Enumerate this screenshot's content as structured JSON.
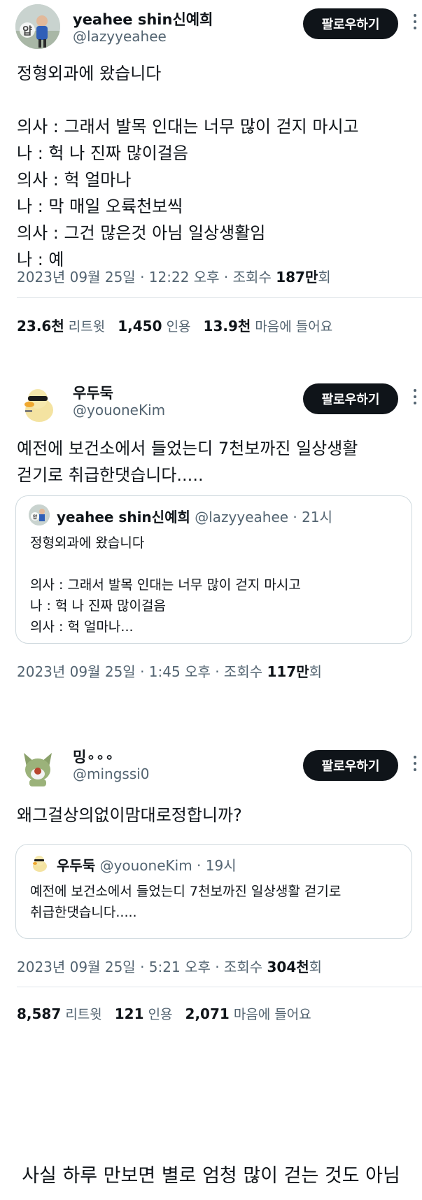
{
  "tweets": [
    {
      "name": "yeahee shin신예희",
      "handle": "@lazyyeahee",
      "follow_label": "팔로우하기",
      "avatar_text": "얍",
      "text": "정형외과에 왔습니다\n\n의사 : 그래서 발목 인대는 너무 많이 걷지 마시고\n나 : 헉 나 진짜 많이걸음\n의사 : 헉 얼마나\n나 : 막 매일 오륙천보씩\n의사 : 그건 많은것 아님 일상생활임\n나 : 예",
      "date": "2023년 09월 25일 · 12:22 오후 · 조회수 ",
      "views": "187만",
      "views_suffix": "회",
      "retweets": "23.6천",
      "retweets_label": "리트윗",
      "quotes": "1,450",
      "quotes_label": "인용",
      "likes": "13.9천",
      "likes_label": "마음에 들어요"
    },
    {
      "name": "우두둑",
      "handle": "@youoneKim",
      "follow_label": "팔로우하기",
      "text": "예전에 보건소에서 들었는디 7천보까진 일상생활\n걷기로 취급한댓습니다.....",
      "quote": {
        "name": "yeahee shin신예희",
        "handle": "@lazyyeahee · 21시",
        "avatar_text": "얍",
        "text": "정형외과에 왔습니다\n\n의사 : 그래서 발목 인대는 너무 많이 걷지 마시고\n나 : 헉 나 진짜 많이걸음\n의사 : 헉 얼마나..."
      },
      "date": "2023년 09월 25일 · 1:45 오후 · 조회수 ",
      "views": "117만",
      "views_suffix": "회"
    },
    {
      "name": "밍∘∘∘",
      "handle": "@mingssi0",
      "follow_label": "팔로우하기",
      "text": "왜그걸상의없이맘대로정합니까?",
      "quote": {
        "name": "우두둑",
        "handle": "@youoneKim · 19시",
        "text": "예전에 보건소에서 들었는디 7천보까진 일상생활 걷기로\n취급한댓습니다....."
      },
      "date": "2023년 09월 25일 · 5:21 오후 · 조회수 ",
      "views": "304천",
      "views_suffix": "회",
      "retweets": "8,587",
      "retweets_label": "리트윗",
      "quotes": "121",
      "quotes_label": "인용",
      "likes": "2,071",
      "likes_label": "마음에 들어요"
    }
  ],
  "caption": "사실 하루 만보면 별로 엄청 많이 걷는 것도 아님",
  "colors": {
    "text": "#0f1419",
    "secondary": "#536471",
    "button": "#0f1419",
    "border": "#cfd9de"
  }
}
